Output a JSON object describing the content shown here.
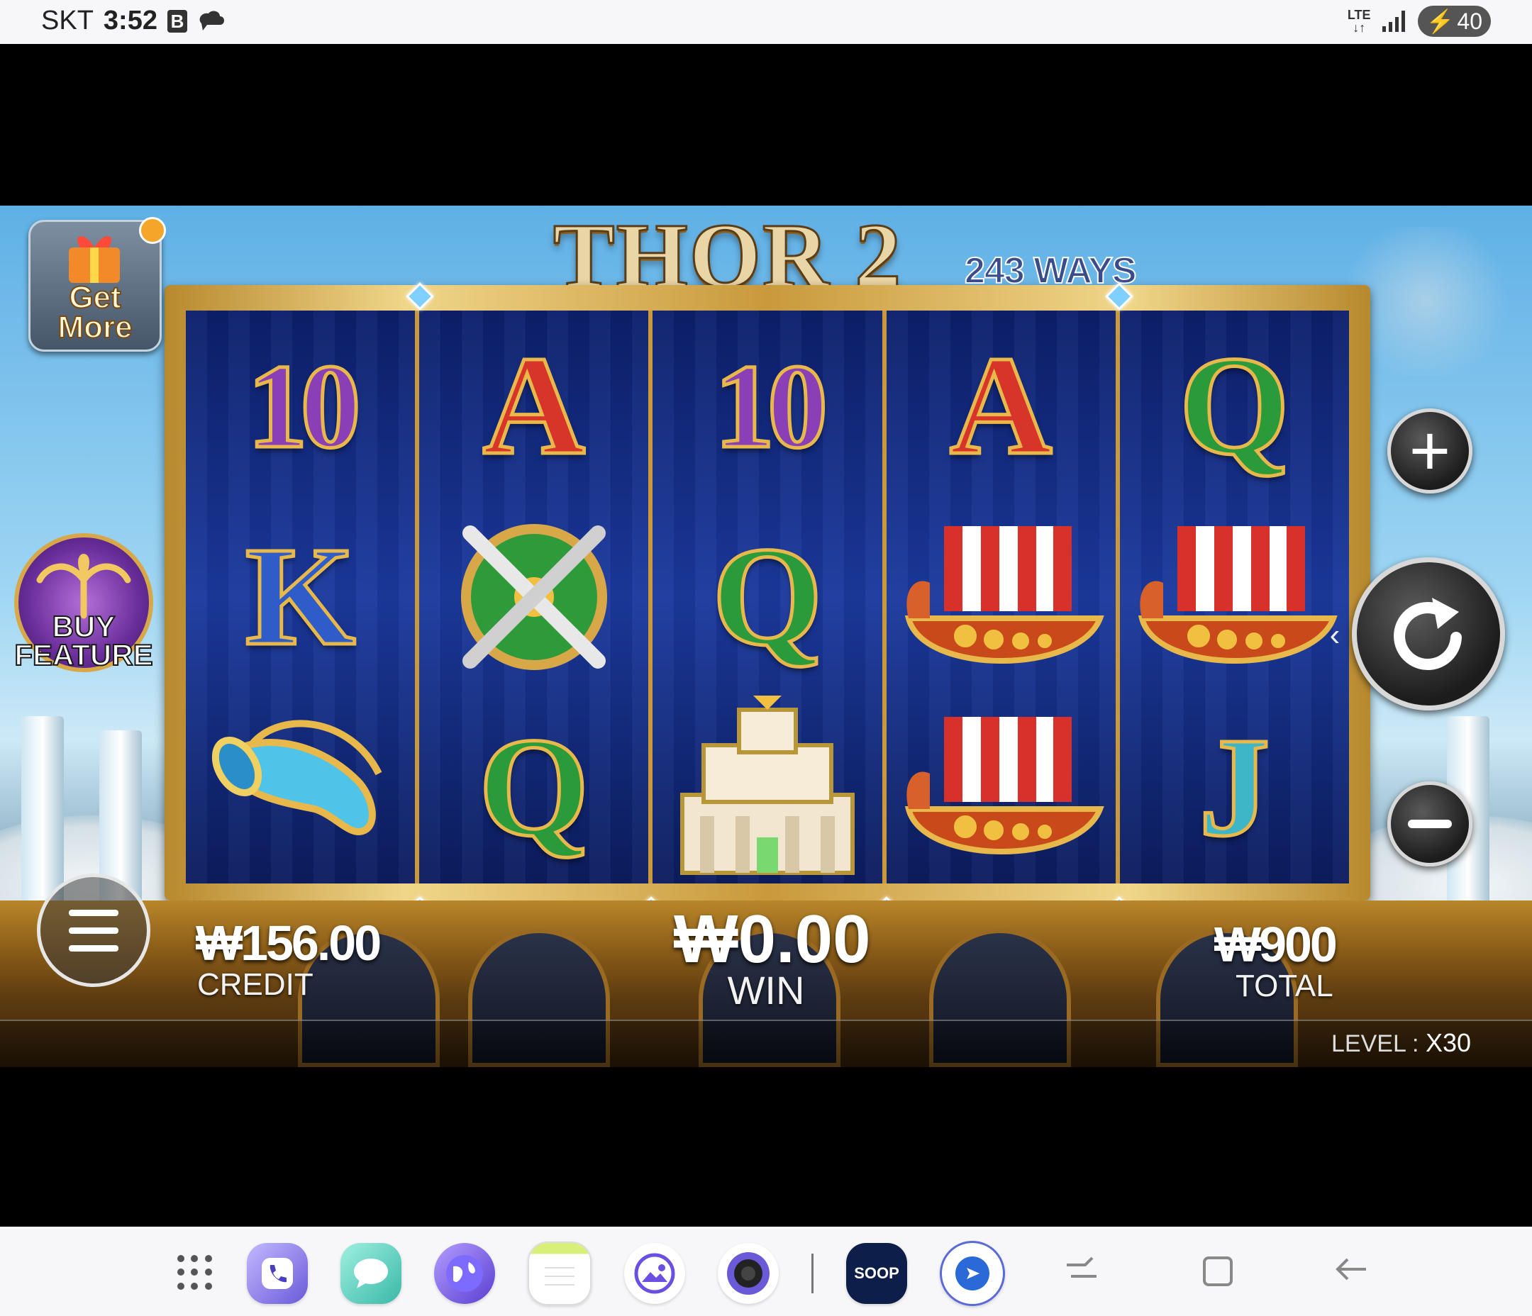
{
  "status": {
    "carrier": "SKT",
    "time": "3:52",
    "network": "LTE",
    "battery": "40"
  },
  "game": {
    "title": "THOR 2",
    "subtitle": "243 WAYS",
    "get_more_label": "Get More",
    "buy_feature_label": "BUY FEATURE",
    "credit_value": "₩156.00",
    "credit_label": "CREDIT",
    "win_value": "₩0.00",
    "win_label": "WIN",
    "total_value": "₩900",
    "total_label": "TOTAL",
    "level_label": "LEVEL : ",
    "level_value": "X30",
    "reels": [
      [
        "10",
        "K",
        "horn"
      ],
      [
        "A",
        "shield",
        "Q"
      ],
      [
        "10",
        "Q",
        "temple"
      ],
      [
        "A",
        "ship",
        "ship"
      ],
      [
        "Q",
        "ship",
        "J"
      ]
    ],
    "symbol_colors": {
      "10": "#8a3fb6",
      "A": "#d8352a",
      "K": "#2e5cc8",
      "Q": "#2a9a3a",
      "J": "#3fb6c8"
    }
  },
  "nav": {
    "dock_apps": [
      "phone-app-icon",
      "messages-app-icon",
      "internet-app-icon",
      "notes-app-icon",
      "gallery-app-icon",
      "camera-app-icon",
      "soop-app-icon",
      "messenger-app-icon"
    ],
    "soop_label": "SOOP"
  }
}
